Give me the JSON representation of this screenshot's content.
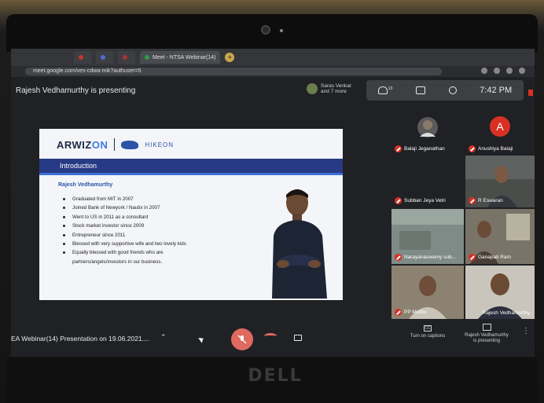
{
  "device": {
    "brand": "DELL"
  },
  "browser": {
    "tabs": [
      {
        "label": ""
      },
      {
        "label": ""
      },
      {
        "label": ""
      },
      {
        "label": "Meet - NTSA Webinar(14)"
      }
    ],
    "url": "meet.google.com/ves-cdwa-mik?authuser=5"
  },
  "meet": {
    "presenting_text": "Rajesh Vedhamurthy is presenting",
    "participant_chip": {
      "line1": "Saras Venkat",
      "line2": "and 7 more"
    },
    "people_count": "10",
    "time": "7:42 PM",
    "meeting_title": "EA Webinar(14) Presentation on 19.06.2021....",
    "captions_label_1": "Turn on captions",
    "present_label_1": "Rajesh Vedhamurthy",
    "present_label_2": "is presenting"
  },
  "slide": {
    "logo_text_1": "ARWIZ",
    "logo_text_2": "ON",
    "logo_text_3": "HIKEON",
    "section_title": "Introduction",
    "speaker": "Rajesh Vedhamurthy",
    "bullets": [
      "Graduated from MIT in 2007",
      "Joined Bank of Newyork / Nautix in 2007",
      "Went to US in 2011 as a consultant",
      "Stock market investor since 2009",
      "Entrepreneur since 2011",
      "Blessed with very supportive wife and two lovely kids",
      "Equally blessed with good friends who are",
      "partners/angels/investors in our business."
    ]
  },
  "participants": [
    {
      "name": "Balaji Jeganathan"
    },
    {
      "name": "Anushiya Balaji",
      "initial": "A"
    },
    {
      "name": "Subban Jeya Vetri"
    },
    {
      "name": "R Eswaran"
    },
    {
      "name": "Narayanaswamy sub..."
    },
    {
      "name": "Ganapati Ram"
    },
    {
      "name": "PP Muthu"
    },
    {
      "name": "Rajesh Vedhamurthy"
    }
  ],
  "colors": {
    "meet_bg": "#202124",
    "slide_bar": "#273a86",
    "mute_red": "#d93025",
    "mic_off_button": "#e06a5f"
  }
}
